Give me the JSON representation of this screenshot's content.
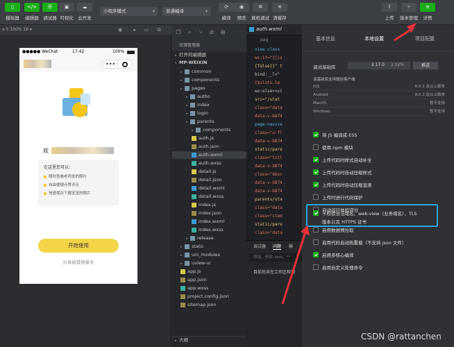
{
  "toolbar": {
    "buttons": [
      {
        "label": "模拟器",
        "icon": "phone-icon"
      },
      {
        "label": "编辑器",
        "icon": "code-icon"
      },
      {
        "label": "调试器",
        "icon": "debug-icon"
      },
      {
        "label": "可视化",
        "icon": "visual-icon"
      },
      {
        "label": "云开发",
        "icon": "cloud-icon"
      }
    ],
    "mode_select": "小程序模式",
    "compile_select": "普通编译",
    "actions": [
      {
        "label": "编译",
        "icon": "refresh-icon"
      },
      {
        "label": "预览",
        "icon": "eye-icon"
      },
      {
        "label": "真机调试",
        "icon": "bug-icon"
      },
      {
        "label": "清缓存",
        "icon": "layers-icon"
      }
    ],
    "right": [
      {
        "label": "上传",
        "icon": "upload-icon"
      },
      {
        "label": "版本管理",
        "icon": "branch-icon"
      },
      {
        "label": "详情",
        "icon": "menu-icon"
      }
    ]
  },
  "simulator": {
    "device_label": "e 5 100% 16 ▾",
    "status": {
      "carrier": "●●●●● WeChat",
      "time": "17:42",
      "battery": "100%"
    },
    "welcome": "欢",
    "intro_title": "在这里您可以：",
    "intro_items": [
      "随时查看老师发的照片",
      "自由便捷点赞评论",
      "快速保存下载宝宝的照片"
    ],
    "start_button": "开始使用",
    "share_link": "分享给其他家长"
  },
  "explorer": {
    "title": "资源管理器",
    "open_editors": "打开的编辑器",
    "project": "MP-WEIXIN",
    "tree": [
      {
        "name": "common",
        "type": "folder",
        "depth": 1
      },
      {
        "name": "components",
        "type": "folder",
        "depth": 1
      },
      {
        "name": "pages",
        "type": "folder",
        "depth": 1
      },
      {
        "name": "autho",
        "type": "folder",
        "depth": 2
      },
      {
        "name": "index",
        "type": "folder",
        "depth": 2
      },
      {
        "name": "login",
        "type": "folder",
        "depth": 2
      },
      {
        "name": "parents",
        "type": "folder",
        "depth": 2
      },
      {
        "name": "components",
        "type": "folder",
        "depth": 3
      },
      {
        "name": "auth.js",
        "type": "js",
        "depth": 3
      },
      {
        "name": "auth.json",
        "type": "json",
        "depth": 3
      },
      {
        "name": "auth.wxml",
        "type": "wxml",
        "depth": 3,
        "selected": true
      },
      {
        "name": "auth.wxss",
        "type": "wxss",
        "depth": 3
      },
      {
        "name": "detail.js",
        "type": "js",
        "depth": 3
      },
      {
        "name": "detail.json",
        "type": "json",
        "depth": 3
      },
      {
        "name": "detail.wxml",
        "type": "wxml",
        "depth": 3
      },
      {
        "name": "detail.wxss",
        "type": "wxss",
        "depth": 3
      },
      {
        "name": "index.js",
        "type": "js",
        "depth": 3
      },
      {
        "name": "index.json",
        "type": "json",
        "depth": 3
      },
      {
        "name": "index.wxml",
        "type": "wxml",
        "depth": 3
      },
      {
        "name": "index.wxss",
        "type": "wxss",
        "depth": 3
      },
      {
        "name": "release",
        "type": "folder",
        "depth": 2
      },
      {
        "name": "static",
        "type": "folder",
        "depth": 1
      },
      {
        "name": "uni_modules",
        "type": "folder",
        "depth": 1
      },
      {
        "name": "uview-ui",
        "type": "folder",
        "depth": 1
      },
      {
        "name": "app.js",
        "type": "js",
        "depth": 1
      },
      {
        "name": "app.json",
        "type": "json",
        "depth": 1
      },
      {
        "name": "app.wxss",
        "type": "wxss",
        "depth": 1
      },
      {
        "name": "project.config.json",
        "type": "json",
        "depth": 1
      },
      {
        "name": "sitemap.json",
        "type": "json",
        "depth": 1
      }
    ],
    "outline": "大纲"
  },
  "editor": {
    "tab": "auth.wxml",
    "breadcrumb": "pag",
    "lines": [
      {
        "text": "view class",
        "color": "#5ab4e8"
      },
      {
        "text": "wx:if=\"{{is",
        "color": "#e07a5f"
      },
      {
        "text": "{false}}\" t",
        "color": "#e8c07d"
      },
      {
        "text": "bind:__l=\"",
        "color": "#c8c8c8"
      },
      {
        "text": "{$slots.le",
        "color": "#e07a5f"
      },
      {
        "text": "wx:else><vi",
        "color": "#c8c8c8"
      },
      {
        "text": "src=\"/stat",
        "color": "#e8c07d"
      },
      {
        "text": "class=\"data",
        "color": "#e07a5f"
      },
      {
        "text": "data-v-b874",
        "color": "#e07a5f"
      },
      {
        "text": "page-navvie",
        "color": "#5ab4e8"
      },
      {
        "text": "class=\"u-fl",
        "color": "#e07a5f"
      },
      {
        "text": "data-v-b874",
        "color": "#e07a5f"
      },
      {
        "text": "static/pare",
        "color": "#e8c07d"
      },
      {
        "text": "class=\"titl",
        "color": "#e07a5f"
      },
      {
        "text": "data-v-b874",
        "color": "#e07a5f"
      },
      {
        "text": "class=\"desc",
        "color": "#e07a5f"
      },
      {
        "text": "data-v-b874",
        "color": "#e07a5f"
      },
      {
        "text": "data-v-b874",
        "color": "#e07a5f"
      },
      {
        "text": "parents/sta",
        "color": "#e8c07d"
      },
      {
        "text": "class=\"data",
        "color": "#e07a5f"
      },
      {
        "text": "class=\"item",
        "color": "#e07a5f"
      },
      {
        "text": "static/pare",
        "color": "#e8c07d"
      },
      {
        "text": "class=\"data",
        "color": "#e07a5f"
      }
    ],
    "console_tabs": [
      "调试器",
      "问题",
      "输"
    ],
    "filter_placeholder": "筛选，例如: text、**",
    "console_message": "目前尚未在工作区检测"
  },
  "details": {
    "tabs": [
      "基本信息",
      "本地设置",
      "项目配置"
    ],
    "lib_label": "调试基础库",
    "lib_version": "2.17.0",
    "lib_percent": "2.12%",
    "push_button": "推送",
    "support_title": "该基础库支持微信客户端",
    "support_rows": [
      {
        "os": "iOS",
        "ver": "8.0.3 及以上版本"
      },
      {
        "os": "Android",
        "ver": "8.0.3 及以上版本"
      },
      {
        "os": "MacOS",
        "ver": "暂不支持"
      },
      {
        "os": "Windows",
        "ver": "暂不支持"
      }
    ],
    "options": [
      {
        "label": "将 JS 编译成 ES5",
        "checked": true
      },
      {
        "label": "使用 npm 模块",
        "checked": false
      },
      {
        "label": "上传代码时样式自动补全",
        "checked": true
      },
      {
        "label": "上传代码时自动压缩样式",
        "checked": true
      },
      {
        "label": "上传代码时自动压缩混淆",
        "checked": true
      },
      {
        "label": "上传时进行代码保护",
        "checked": false
      },
      {
        "label": "自动运行体验评分",
        "checked": false
      },
      {
        "label": "不校验合法域名、web-view（业务域名）、TLS",
        "label2": "版本以及 HTTPS 证书",
        "checked": true
      },
      {
        "label": "启用数据预拉取",
        "checked": false
      },
      {
        "label": "启用代码自动热重载（不支持 json 文件）",
        "checked": false
      },
      {
        "label": "启用多核心编译",
        "checked": true
      },
      {
        "label": "启用自定义处理命令",
        "checked": false
      }
    ],
    "accent": "#1aad19",
    "highlight_color": "#2aa6e0",
    "annotation_color": "#e8313a"
  },
  "watermark": "CSDN @rattanchen"
}
